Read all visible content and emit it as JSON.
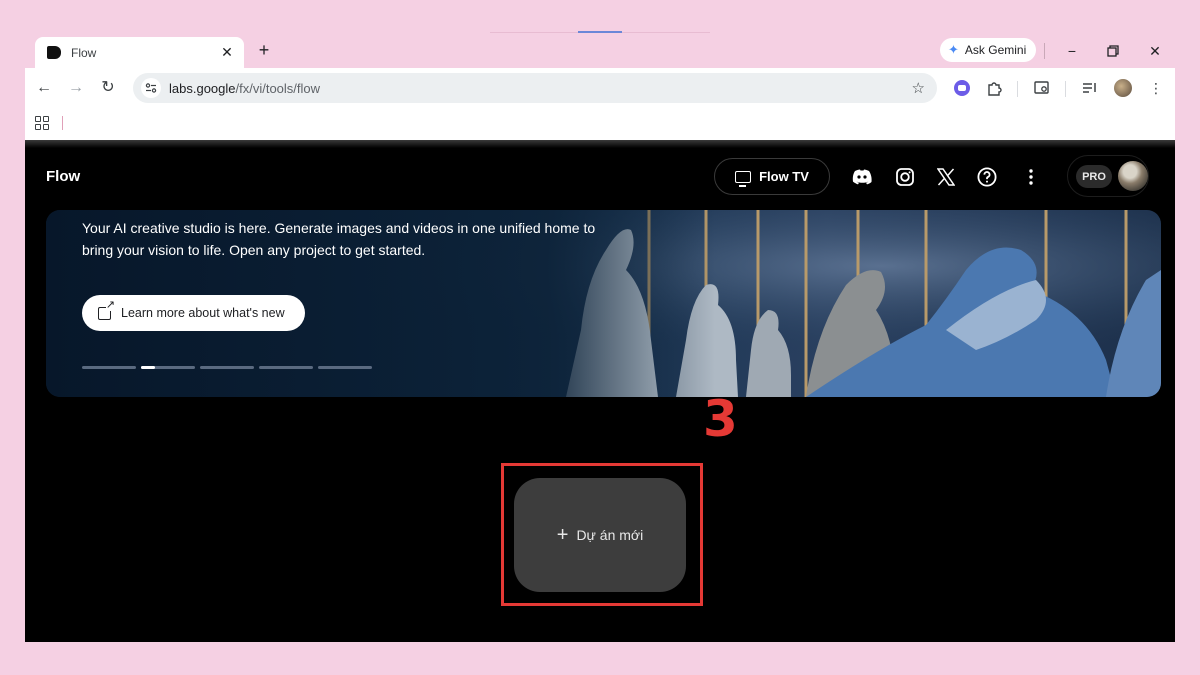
{
  "browser": {
    "tab_title": "Flow",
    "new_tab": "+",
    "ask_gemini": "Ask Gemini",
    "url_host": "labs.google",
    "url_path": "/fx/vi/tools/flow"
  },
  "header": {
    "brand": "Flow",
    "flow_tv": "Flow TV",
    "pro_badge": "PRO"
  },
  "banner": {
    "text": "Your AI creative studio is here. Generate images and videos in one unified home to bring your vision to life. Open any project to get started.",
    "learn_more": "Learn more about what's new",
    "slides": 5,
    "active_slide": 2
  },
  "main": {
    "new_project_label": "Dự án mới",
    "new_project_icon": "plus-icon"
  },
  "annotation": {
    "step_number": "3",
    "color": "#e53935"
  },
  "colors": {
    "page_background": "#000000",
    "outer_background": "#f5d0e3",
    "new_project_bg": "#3d3d3d"
  }
}
